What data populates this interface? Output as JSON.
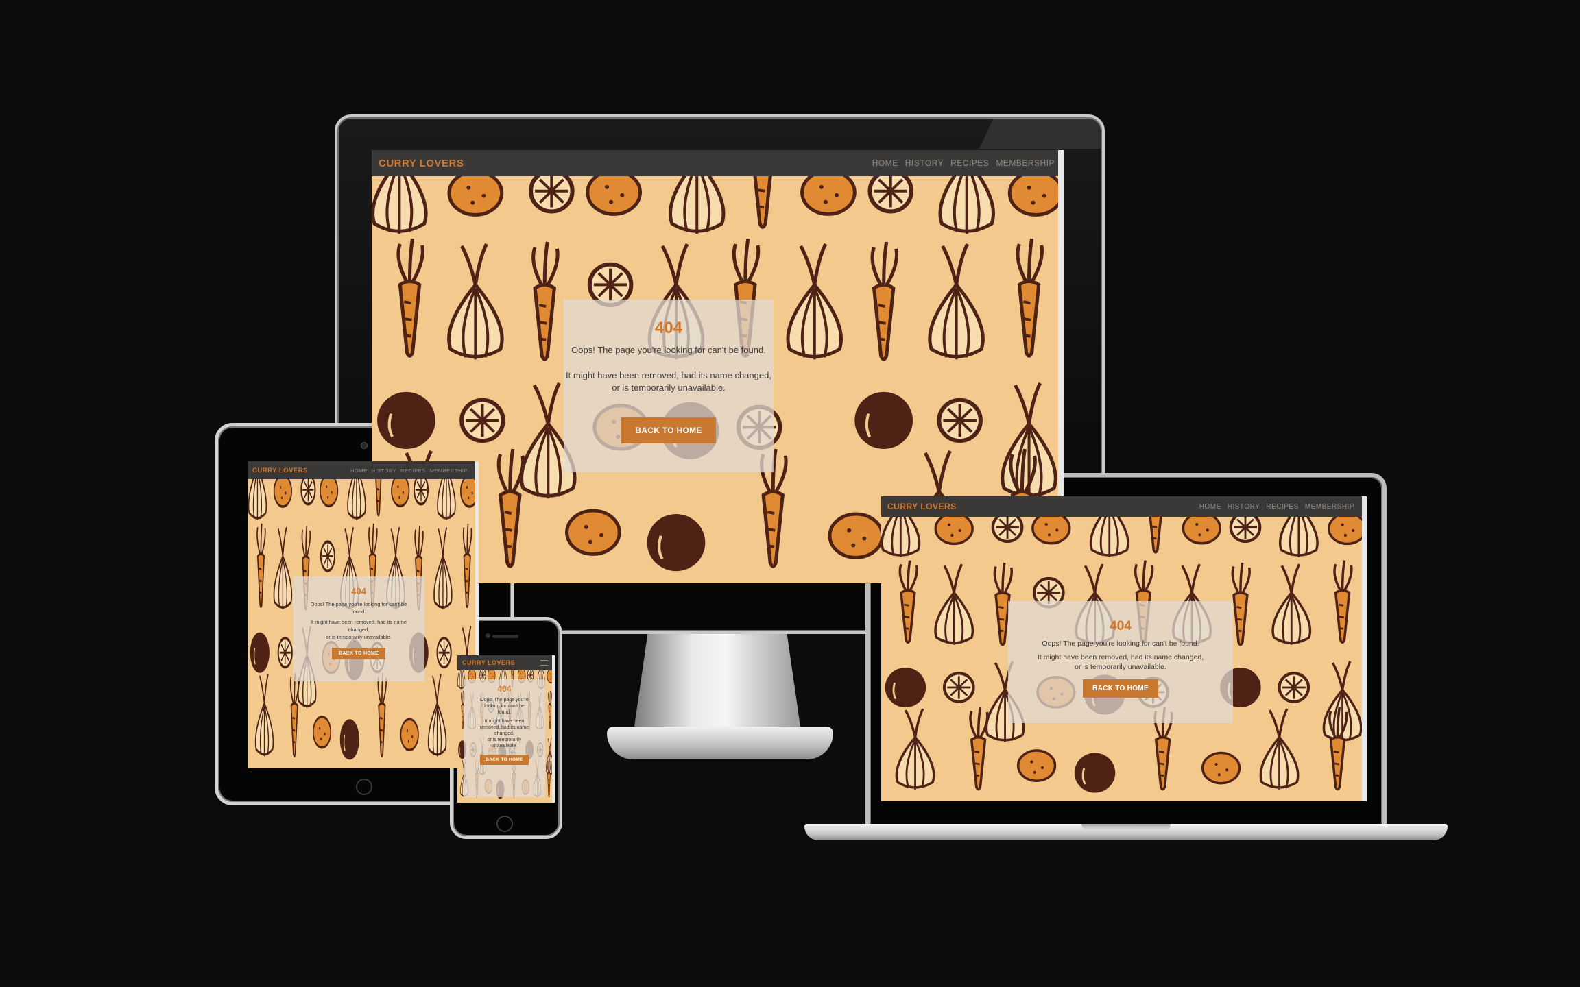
{
  "site": {
    "brand": "CURRY LOVERS",
    "nav": [
      "HOME",
      "HISTORY",
      "RECIPES",
      "MEMBERSHIP"
    ]
  },
  "error_card": {
    "code": "404",
    "message": "Oops! The page you're looking for can't be found.",
    "detail_line1": "It might have been removed, had its name changed,",
    "detail_line2": "or is temporarily unavailable.",
    "button_label": "BACK TO HOME"
  },
  "tablet_card": {
    "message_line1": "Oops! The page you're looking for can't be",
    "message_line2": "found.",
    "detail_line1": "It might have been removed, had its name",
    "detail_line2": "changed,",
    "detail_line3": "or is temporarily unavailable."
  },
  "phone_card": {
    "message_line1": "Oops! The page you're",
    "message_line2": "looking for can't be",
    "message_line3": "found.",
    "detail_line1": "It might have been",
    "detail_line2": "removed, had its name",
    "detail_line3": "changed,",
    "detail_line4": "or is temporarily",
    "detail_line5": "unavailable."
  },
  "colors": {
    "accent": "#d2782b",
    "navbar": "#3b3938",
    "background": "#f3c98e",
    "vegetable_dark": "#4e2316",
    "vegetable_orange": "#e08a34"
  },
  "icons": {
    "menu": "hamburger-menu-icon"
  }
}
